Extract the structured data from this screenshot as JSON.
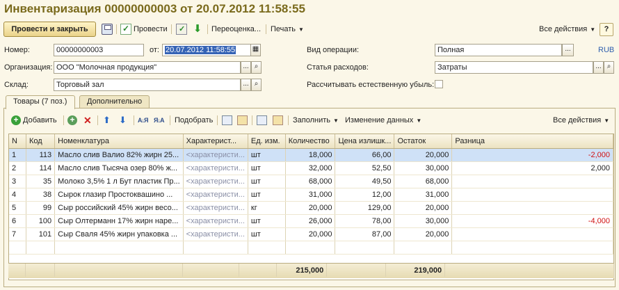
{
  "window": {
    "title": "Инвентаризация 00000000003 от 20.07.2012 11:58:55"
  },
  "toolbar": {
    "post_close": "Провести и закрыть",
    "post": "Провести",
    "revalue": "Переоценка...",
    "print": "Печать",
    "all_actions": "Все действия",
    "help": "?"
  },
  "form": {
    "number_label": "Номер:",
    "number_value": "00000000003",
    "from_label": "от:",
    "date_value": "20.07.2012 11:58:55",
    "org_label": "Организация:",
    "org_value": "ООО \"Молочная продукция\"",
    "warehouse_label": "Склад:",
    "warehouse_value": "Торговый зал",
    "operation_label": "Вид операции:",
    "operation_value": "Полная",
    "currency": "RUB",
    "expense_label": "Статья расходов:",
    "expense_value": "Затраты",
    "natural_loss_label": "Рассчитывать естественную убыль:"
  },
  "tabs": [
    {
      "label": "Товары (7 поз.)"
    },
    {
      "label": "Дополнительно"
    }
  ],
  "table_toolbar": {
    "add": "Добавить",
    "pick": "Подобрать",
    "fill": "Заполнить",
    "change_data": "Изменение данных",
    "all_actions": "Все действия"
  },
  "table": {
    "columns": [
      "N",
      "Код",
      "Номенклатура",
      "Характерист...",
      "Ед. изм.",
      "Количество",
      "Цена излишк...",
      "Остаток",
      "Разница"
    ],
    "rows": [
      {
        "n": "1",
        "code": "113",
        "name": "Масло слив Валио 82% жирн 25...",
        "char": "<характеристи...",
        "unit": "шт",
        "qty": "18,000",
        "price": "66,00",
        "rest": "20,000",
        "diff": "-2,000"
      },
      {
        "n": "2",
        "code": "114",
        "name": "Масло слив Тысяча озер 80% ж...",
        "char": "<характеристи...",
        "unit": "шт",
        "qty": "32,000",
        "price": "52,50",
        "rest": "30,000",
        "diff": "2,000"
      },
      {
        "n": "3",
        "code": "35",
        "name": "Молоко 3,5% 1 л Бут пластик Пр...",
        "char": "<характеристи...",
        "unit": "шт",
        "qty": "68,000",
        "price": "49,50",
        "rest": "68,000",
        "diff": ""
      },
      {
        "n": "4",
        "code": "38",
        "name": "Сырок глазир   Простоквашино ...",
        "char": "<характеристи...",
        "unit": "шт",
        "qty": "31,000",
        "price": "12,00",
        "rest": "31,000",
        "diff": ""
      },
      {
        "n": "5",
        "code": "99",
        "name": "Сыр российский 45% жирн весо...",
        "char": "<характеристи...",
        "unit": "кг",
        "qty": "20,000",
        "price": "129,00",
        "rest": "20,000",
        "diff": ""
      },
      {
        "n": "6",
        "code": "100",
        "name": "Сыр Олтерманн 17% жирн наре...",
        "char": "<характеристи...",
        "unit": "шт",
        "qty": "26,000",
        "price": "78,00",
        "rest": "30,000",
        "diff": "-4,000"
      },
      {
        "n": "7",
        "code": "101",
        "name": "Сыр Сваля 45% жирн упаковка ...",
        "char": "<характеристи...",
        "unit": "шт",
        "qty": "20,000",
        "price": "87,00",
        "rest": "20,000",
        "diff": ""
      }
    ],
    "totals": {
      "qty": "215,000",
      "rest": "219,000"
    }
  },
  "colors": {
    "negative": "#d01010",
    "selection": "#cfe1f7",
    "accent": "#7a6a1c"
  }
}
